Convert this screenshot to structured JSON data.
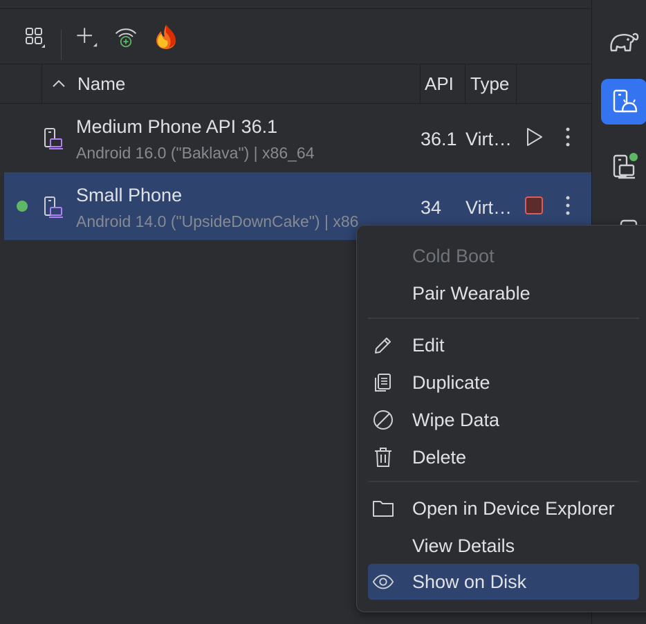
{
  "toolbar": {
    "icons": [
      "device-group-icon",
      "add-icon",
      "wifi-pairing-icon",
      "firebase-icon"
    ]
  },
  "table": {
    "columns": {
      "name": "Name",
      "api": "API",
      "type": "Type"
    },
    "rows": [
      {
        "name": "Medium Phone API 36.1",
        "details": "Android 16.0 (\"Baklava\") | x86_64",
        "api": "36.1",
        "type": "Virt…",
        "action": "run",
        "running": false
      },
      {
        "name": "Small Phone",
        "details": "Android 14.0 (\"UpsideDownCake\") | x86",
        "api": "34",
        "type": "Virt…",
        "action": "stop",
        "running": true
      }
    ]
  },
  "context_menu": {
    "items": [
      {
        "label": "Cold Boot",
        "enabled": false,
        "icon": ""
      },
      {
        "label": "Pair Wearable",
        "enabled": true,
        "icon": ""
      },
      {
        "label": "Edit",
        "enabled": true,
        "icon": "pencil-icon"
      },
      {
        "label": "Duplicate",
        "enabled": true,
        "icon": "copy-icon"
      },
      {
        "label": "Wipe Data",
        "enabled": true,
        "icon": "prohibited-icon"
      },
      {
        "label": "Delete",
        "enabled": true,
        "icon": "trash-icon"
      },
      {
        "label": "Open in Device Explorer",
        "enabled": true,
        "icon": "folder-icon"
      },
      {
        "label": "View Details",
        "enabled": true,
        "icon": ""
      },
      {
        "label": "Show on Disk",
        "enabled": true,
        "icon": "eye-icon",
        "highlighted": true
      }
    ]
  },
  "sidebar": {
    "icons": [
      "gradle-elephant-icon",
      "device-manager-icon",
      "running-devices-icon",
      "device-mirror-icon"
    ],
    "active": "device-manager-icon"
  },
  "colors": {
    "accent": "#3574f0",
    "selection": "#2e436e",
    "running_dot": "#5fb865",
    "stop_square": "#5c2b2b"
  }
}
